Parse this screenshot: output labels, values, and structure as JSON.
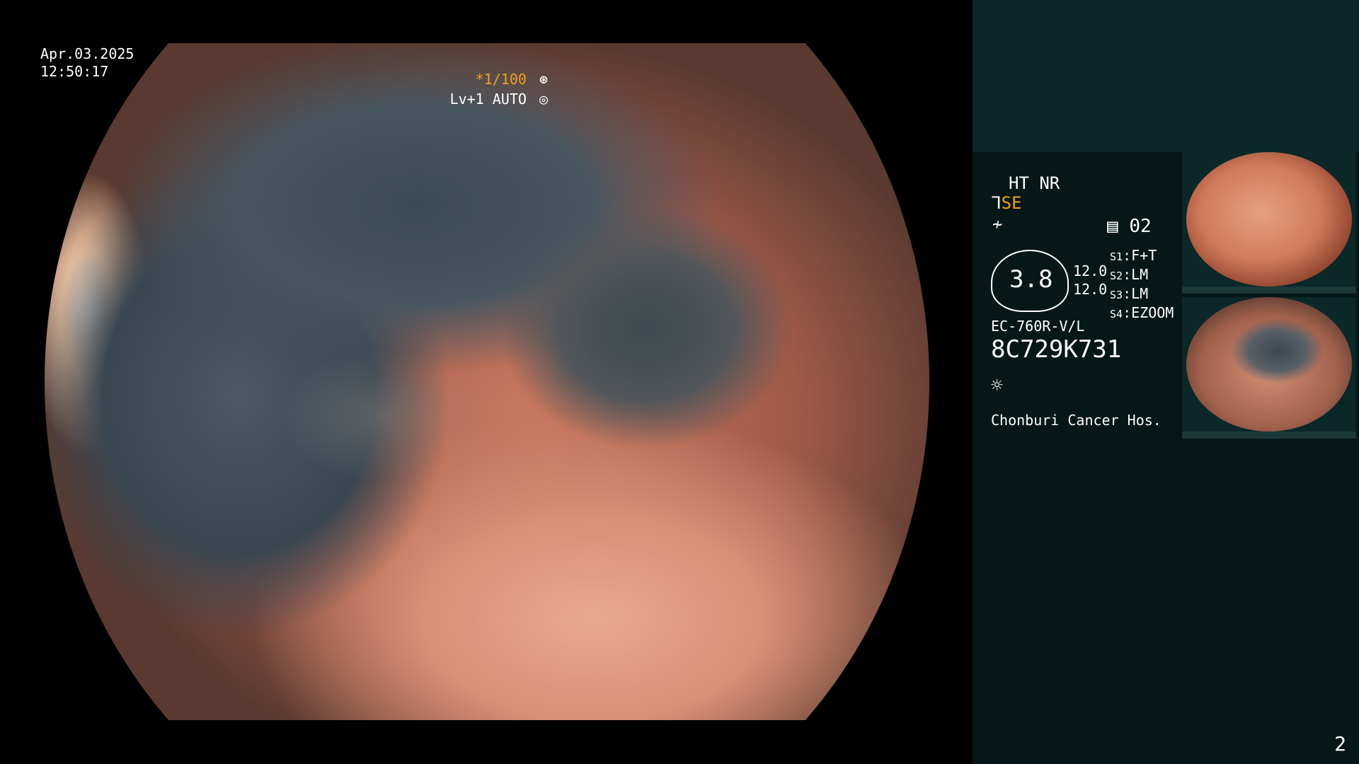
{
  "overlay": {
    "date": "Apr.03.2025",
    "time": "12:50:17",
    "shutter": "*1/100",
    "level": "Lv+1 AUTO"
  },
  "panel": {
    "mode": "HT NR",
    "se_label": "SE",
    "preset": "02",
    "value_main": "3.8",
    "value_a": "12.0",
    "value_b": "12.0",
    "s_labels": [
      "S1",
      "S2",
      "S3",
      "S4"
    ],
    "s_values": [
      "F+T",
      "LM",
      "LM",
      "EZOOM"
    ],
    "scope_model": "EC-760R-V/L",
    "scope_id": "8C729K731",
    "hospital": "Chonburi Cancer Hos."
  },
  "page_number": "2",
  "icons": {
    "shutter": "aperture-icon",
    "auto": "auto-exposure-icon",
    "light": "sun-icon",
    "scope_tip": "scope-tip-icon",
    "wave": "wave-icon",
    "doc": "document-icon"
  },
  "colors": {
    "panel_bg": "#061717",
    "panel_top_bg": "#0b2727",
    "accent_orange": "#f0a020"
  }
}
